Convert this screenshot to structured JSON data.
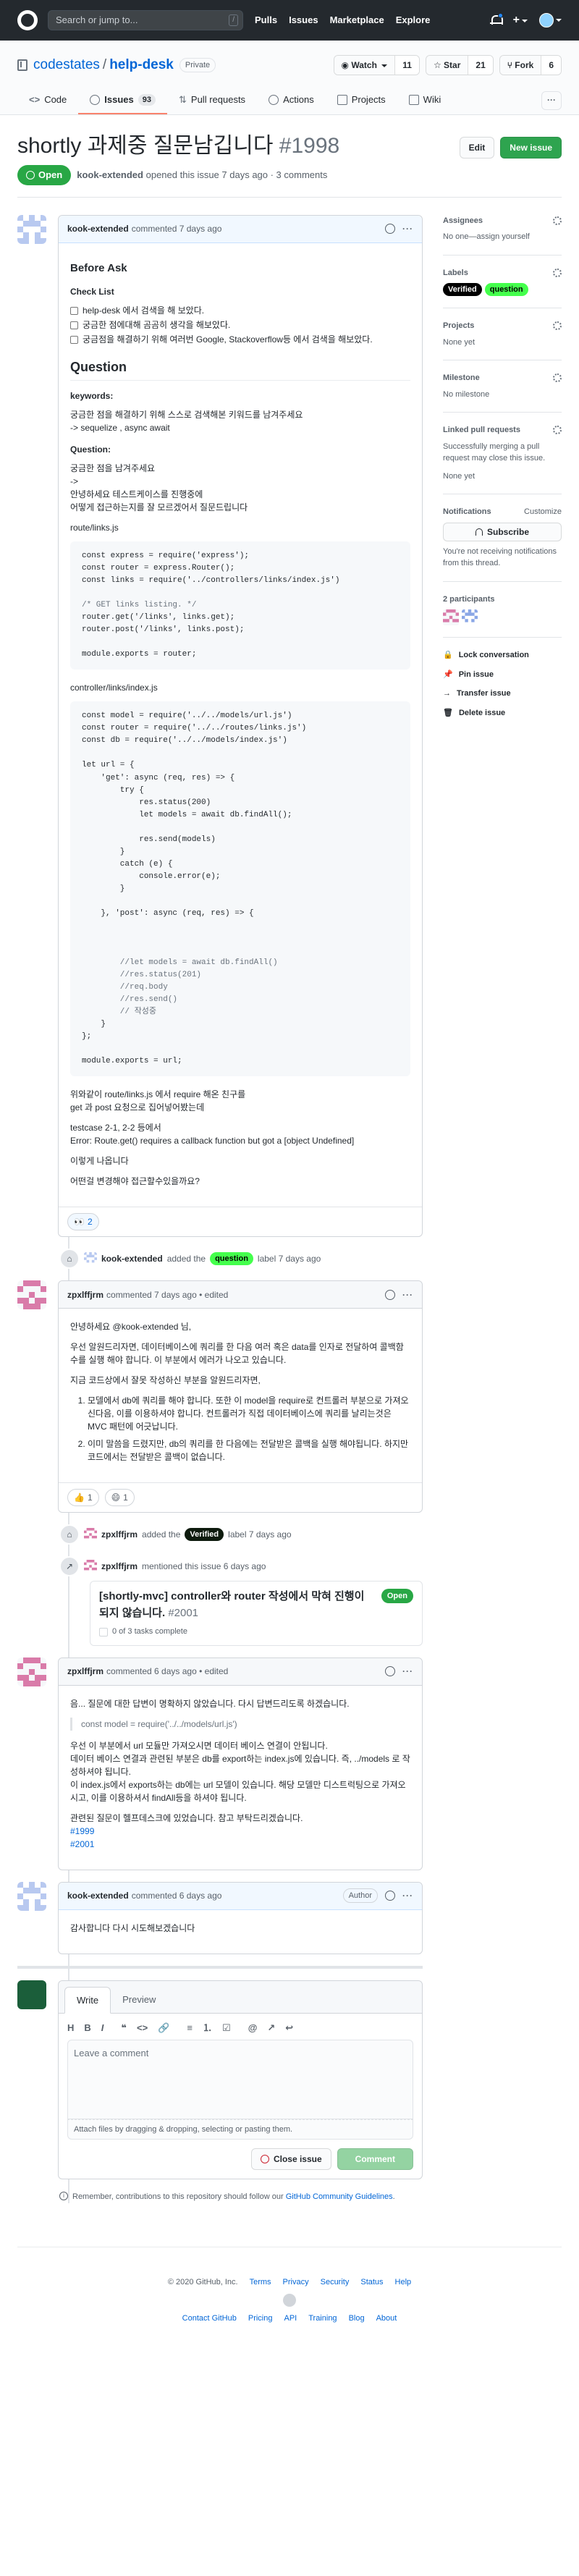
{
  "header": {
    "search_placeholder": "Search or jump to...",
    "search_key": "/",
    "nav": [
      "Pulls",
      "Issues",
      "Marketplace",
      "Explore"
    ],
    "plus": "+"
  },
  "repo": {
    "owner": "codestates",
    "name": "help-desk",
    "visibility": "Private",
    "watch": {
      "label": "Watch",
      "count": "11"
    },
    "star": {
      "label": "Star",
      "count": "21"
    },
    "fork": {
      "label": "Fork",
      "count": "6"
    },
    "tabs": [
      {
        "label": "Code"
      },
      {
        "label": "Issues",
        "count": "93"
      },
      {
        "label": "Pull requests"
      },
      {
        "label": "Actions"
      },
      {
        "label": "Projects"
      },
      {
        "label": "Wiki"
      }
    ]
  },
  "issue": {
    "title": "shortly 과제중 질문남깁니다",
    "number": "#1998",
    "edit_label": "Edit",
    "new_issue_label": "New issue",
    "state": "Open",
    "author": "kook-extended",
    "meta": "opened this issue 7 days ago · 3 comments"
  },
  "first_comment": {
    "author": "kook-extended",
    "time": "commented 7 days ago",
    "h_before": "Before Ask",
    "h_checklist": "Check List",
    "checklist": [
      "help-desk 에서 검색을 해 보았다.",
      "궁금한 점에대해 곰곰히 생각을 해보았다.",
      "궁금점을 해결하기 위해 여러번 Google, Stackoverflow등 에서 검색을 해보았다."
    ],
    "h_question": "Question",
    "kw_title": "keywords:",
    "kw_line1": "궁금한 점을 해결하기 위해 스스로 검색해본 키워드를 남겨주세요",
    "kw_line2": "-> sequelize , async await",
    "q_title": "Question:",
    "q_line1": "궁금한 점을 남겨주세요",
    "q_line2": "->",
    "q_line3": "안녕하세요 테스트케이스를 진행중에",
    "q_line4": "어떻게 접근하는지를 잘 모르겠어서 질문드립니다",
    "file1": "route/links.js",
    "code1": [
      "const express = require('express');",
      "const router = express.Router();",
      "const links = require('../controllers/links/index.js')",
      "",
      "/* GET links listing. */",
      "router.get('/links', links.get);",
      "router.post('/links', links.post);",
      "",
      "module.exports = router;"
    ],
    "file2": "controller/links/index.js",
    "code2": [
      "const model = require('../../models/url.js')",
      "const router = require('../../routes/links.js')",
      "const db = require('../../models/index.js')",
      "",
      "let url = {",
      "    'get': async (req, res) => {",
      "        try {",
      "            res.status(200)",
      "            let models = await db.findAll();",
      "",
      "            res.send(models)",
      "        }",
      "        catch (e) {",
      "            console.error(e);",
      "        }",
      "",
      "    }, 'post': async (req, res) => {",
      "",
      "",
      "",
      "        //let models = await db.findAll()",
      "        //res.status(201)",
      "        //req.body",
      "        //res.send()",
      "        // 작성중",
      "    }",
      "};",
      "",
      "module.exports = url;"
    ],
    "after1": "위와같이 route/links.js 에서 require 해온 친구를",
    "after2": "get 과 post 요청으로 집어넣어봤는데",
    "after3": "testcase 2-1, 2-2 등에서",
    "after4": "Error: Route.get() requires a callback function but got a [object Undefined]",
    "after5": "이렇게 나옵니다",
    "after6": "어떤걸 변경해야 접근할수있을까요?",
    "reaction": {
      "emoji": "👀",
      "count": "2"
    }
  },
  "event_label1": {
    "actor": "kook-extended",
    "text": "added the",
    "label": "question",
    "tail": "label 7 days ago"
  },
  "second_comment": {
    "author": "zpxlffjrm",
    "time": "commented 7 days ago",
    "edited": "• edited",
    "p1": "안녕하세요 @kook-extended 님,",
    "p2": "우선 알원드리자면, 데이터베이스에 쿼리를 한 다음 여러 혹은 data를 인자로 전달하여 콜백함수를 실행 해야 합니다. 이 부분에서 에러가 나오고 있습니다.",
    "p3": "지금 코드상에서 잘못 작성하신 부분을 알원드리자면,",
    "li1": "모델에서 db에 쿼리를 해야 합니다. 또한 이 model을 require로 컨트롤러 부분으로 가져오신다음, 이를 이용하셔야 합니다. 컨트롤러가 직접 데이터베이스에 쿼리를 날리는것은 MVC 패턴에 어긋납니다.",
    "li2": "이미 말씀을 드렸지만, db의 쿼리를 한 다음에는 전달받은 콜백을 실행 해야됩니다. 하지만 코드에서는 전달받은 콜백이 없습니다.",
    "reactions": [
      {
        "emoji": "👍",
        "count": "1"
      },
      {
        "emoji": "😄",
        "count": "1"
      }
    ]
  },
  "event_label2": {
    "actor": "zpxlffjrm",
    "text": "added the",
    "label": "Verified",
    "tail": "label 7 days ago"
  },
  "event_mention": {
    "actor": "zpxlffjrm",
    "text": "mentioned this issue 6 days ago"
  },
  "xref": {
    "title": "[shortly-mvc] controller와 router 작성에서 막혀 진행이 되지 않습니다.",
    "number": "#2001",
    "state": "Open",
    "tasks": "0 of 3 tasks complete"
  },
  "third_comment": {
    "author": "zpxlffjrm",
    "time": "commented 6 days ago",
    "edited": "• edited",
    "p1": "음... 질문에 대한 답변이 명확하지 않았습니다. 다시 답변드리도록 하겠습니다.",
    "quote": "const model = require('../../models/url.js')",
    "p2": "우선 이 부분에서 url 모듈만 가져오시면 데이터 베이스 연결이 안됩니다.",
    "p3": "데이터 베이스 연결과 관련된 부분은 db를 export하는 index.js에 있습니다. 즉, ../models 로 작성하셔야 됩니다.",
    "p4": "이 index.js에서 exports하는 db에는 url 모델이 있습니다. 해당 모델만 디스트럭팅으로 가져오시고, 이를 이용하셔서 findAll등을 하셔야 됩니다.",
    "p5": "관련된 질문이 헬프데스크에 있었습니다. 참고 부탁드리겠습니다.",
    "link1": "#1999",
    "link2": "#2001"
  },
  "fourth_comment": {
    "author": "kook-extended",
    "time": "commented 6 days ago",
    "badge": "Author",
    "body": "감사합니다 다시 시도해보겠습니다"
  },
  "new_comment": {
    "tab_write": "Write",
    "tab_preview": "Preview",
    "placeholder": "Leave a comment",
    "attach": "Attach files by dragging & dropping, selecting or pasting them.",
    "close_label": "Close issue",
    "comment_label": "Comment",
    "tip_prefix": "Remember, contributions to this repository should follow our",
    "tip_link": "GitHub Community Guidelines",
    "tip_suffix": "."
  },
  "sidebar": {
    "assignees_title": "Assignees",
    "assignees_value": "No one—assign yourself",
    "labels_title": "Labels",
    "labels": [
      "Verified",
      "question"
    ],
    "projects_title": "Projects",
    "projects_value": "None yet",
    "milestone_title": "Milestone",
    "milestone_value": "No milestone",
    "linked_title": "Linked pull requests",
    "linked_desc": "Successfully merging a pull request may close this issue.",
    "linked_value": "None yet",
    "notif_title": "Notifications",
    "notif_customize": "Customize",
    "subscribe": "Subscribe",
    "notif_desc": "You're not receiving notifications from this thread.",
    "participants_title": "2 participants",
    "lock": "Lock conversation",
    "pin": "Pin issue",
    "transfer": "Transfer issue",
    "delete": "Delete issue"
  },
  "footer": {
    "copyright": "© 2020 GitHub, Inc.",
    "row1": [
      "Terms",
      "Privacy",
      "Security",
      "Status",
      "Help"
    ],
    "row2": [
      "Contact GitHub",
      "Pricing",
      "API",
      "Training",
      "Blog",
      "About"
    ]
  },
  "colors": {
    "header_bg": "#24292e",
    "open_green": "#28a745",
    "link_blue": "#0366d6",
    "label_question": "#44ff4c",
    "label_verified": "#0e1b0e"
  }
}
